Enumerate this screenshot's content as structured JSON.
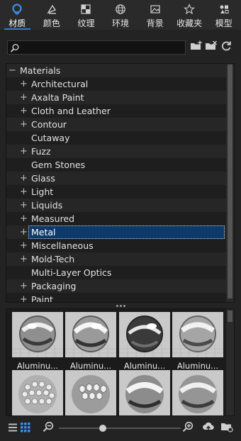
{
  "tabs": [
    {
      "label": "材质",
      "icon": "material-icon",
      "active": true
    },
    {
      "label": "颜色",
      "icon": "color-icon",
      "active": false
    },
    {
      "label": "纹理",
      "icon": "texture-icon",
      "active": false
    },
    {
      "label": "环境",
      "icon": "environment-icon",
      "active": false
    },
    {
      "label": "背景",
      "icon": "background-icon",
      "active": false
    },
    {
      "label": "收藏夹",
      "icon": "favorites-icon",
      "active": false
    },
    {
      "label": "模型",
      "icon": "model-icon",
      "active": false
    }
  ],
  "search": {
    "value": "",
    "placeholder": ""
  },
  "tree": {
    "root": {
      "label": "Materials",
      "expander": "−"
    },
    "items": [
      {
        "label": "Architectural",
        "expander": "+"
      },
      {
        "label": "Axalta Paint",
        "expander": "+"
      },
      {
        "label": "Cloth and Leather",
        "expander": "+"
      },
      {
        "label": "Contour",
        "expander": "+"
      },
      {
        "label": "Cutaway",
        "expander": ""
      },
      {
        "label": "Fuzz",
        "expander": "+"
      },
      {
        "label": "Gem Stones",
        "expander": ""
      },
      {
        "label": "Glass",
        "expander": "+"
      },
      {
        "label": "Light",
        "expander": "+"
      },
      {
        "label": "Liquids",
        "expander": "+"
      },
      {
        "label": "Measured",
        "expander": "+"
      },
      {
        "label": "Metal",
        "expander": "+",
        "selected": true
      },
      {
        "label": "Miscellaneous",
        "expander": "+"
      },
      {
        "label": "Mold-Tech",
        "expander": "+"
      },
      {
        "label": "Multi-Layer Optics",
        "expander": ""
      },
      {
        "label": "Packaging",
        "expander": "+"
      },
      {
        "label": "Paint",
        "expander": "+"
      }
    ]
  },
  "thumbnails": [
    {
      "caption": "Aluminu..."
    },
    {
      "caption": "Aluminu..."
    },
    {
      "caption": "Aluminu..."
    },
    {
      "caption": "Aluminu..."
    },
    {
      "caption": ""
    },
    {
      "caption": ""
    },
    {
      "caption": ""
    },
    {
      "caption": ""
    }
  ],
  "zoom": {
    "level": 0.35
  },
  "colors": {
    "accent": "#2f7dd1",
    "selection": "#0e3a6b",
    "panel": "#232323"
  }
}
